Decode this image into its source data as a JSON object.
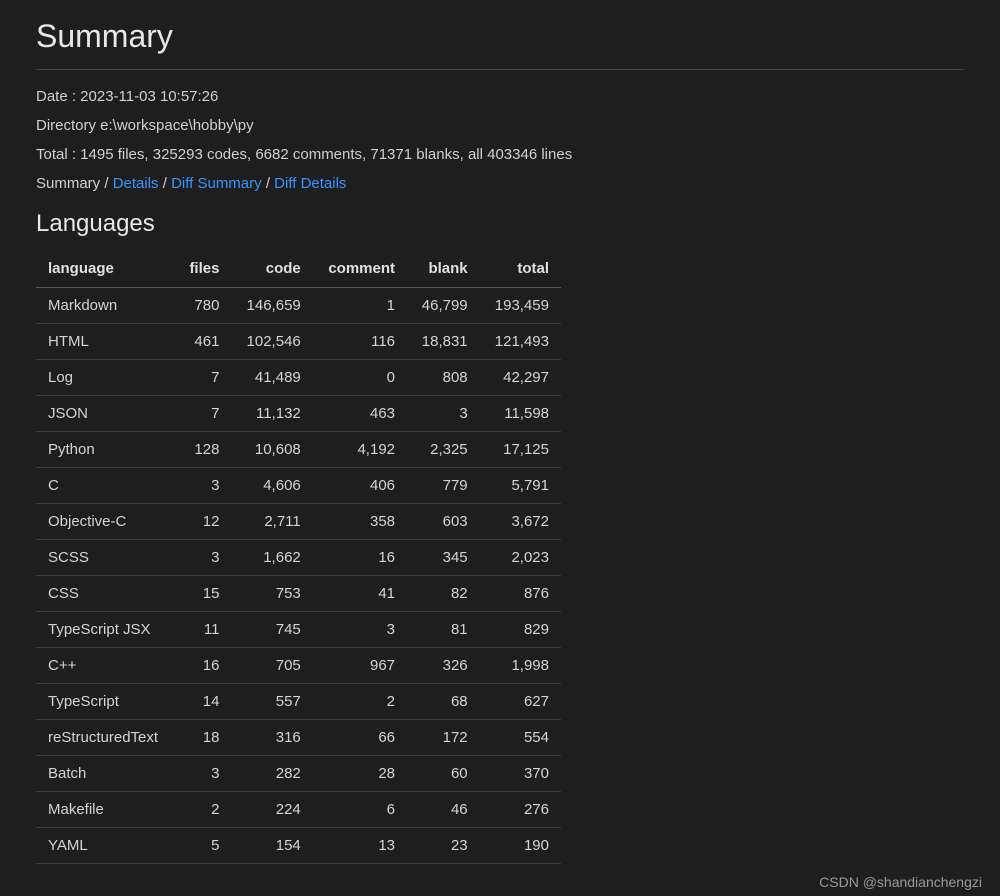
{
  "title": "Summary",
  "date_line": "Date : 2023-11-03 10:57:26",
  "directory_line": "Directory e:\\workspace\\hobby\\py",
  "total_line": "Total : 1495 files, 325293 codes, 6682 comments, 71371 blanks, all 403346 lines",
  "breadcrumb": {
    "summary": "Summary",
    "details": "Details",
    "diff_summary": "Diff Summary",
    "diff_details": "Diff Details"
  },
  "section_languages": "Languages",
  "columns": {
    "language": "language",
    "files": "files",
    "code": "code",
    "comment": "comment",
    "blank": "blank",
    "total": "total"
  },
  "rows": [
    {
      "language": "Markdown",
      "files": "780",
      "code": "146,659",
      "comment": "1",
      "blank": "46,799",
      "total": "193,459"
    },
    {
      "language": "HTML",
      "files": "461",
      "code": "102,546",
      "comment": "116",
      "blank": "18,831",
      "total": "121,493"
    },
    {
      "language": "Log",
      "files": "7",
      "code": "41,489",
      "comment": "0",
      "blank": "808",
      "total": "42,297"
    },
    {
      "language": "JSON",
      "files": "7",
      "code": "11,132",
      "comment": "463",
      "blank": "3",
      "total": "11,598"
    },
    {
      "language": "Python",
      "files": "128",
      "code": "10,608",
      "comment": "4,192",
      "blank": "2,325",
      "total": "17,125"
    },
    {
      "language": "C",
      "files": "3",
      "code": "4,606",
      "comment": "406",
      "blank": "779",
      "total": "5,791"
    },
    {
      "language": "Objective-C",
      "files": "12",
      "code": "2,711",
      "comment": "358",
      "blank": "603",
      "total": "3,672"
    },
    {
      "language": "SCSS",
      "files": "3",
      "code": "1,662",
      "comment": "16",
      "blank": "345",
      "total": "2,023"
    },
    {
      "language": "CSS",
      "files": "15",
      "code": "753",
      "comment": "41",
      "blank": "82",
      "total": "876"
    },
    {
      "language": "TypeScript JSX",
      "files": "11",
      "code": "745",
      "comment": "3",
      "blank": "81",
      "total": "829"
    },
    {
      "language": "C++",
      "files": "16",
      "code": "705",
      "comment": "967",
      "blank": "326",
      "total": "1,998"
    },
    {
      "language": "TypeScript",
      "files": "14",
      "code": "557",
      "comment": "2",
      "blank": "68",
      "total": "627"
    },
    {
      "language": "reStructuredText",
      "files": "18",
      "code": "316",
      "comment": "66",
      "blank": "172",
      "total": "554"
    },
    {
      "language": "Batch",
      "files": "3",
      "code": "282",
      "comment": "28",
      "blank": "60",
      "total": "370"
    },
    {
      "language": "Makefile",
      "files": "2",
      "code": "224",
      "comment": "6",
      "blank": "46",
      "total": "276"
    },
    {
      "language": "YAML",
      "files": "5",
      "code": "154",
      "comment": "13",
      "blank": "23",
      "total": "190"
    }
  ],
  "watermark": "CSDN @shandianchengzi"
}
